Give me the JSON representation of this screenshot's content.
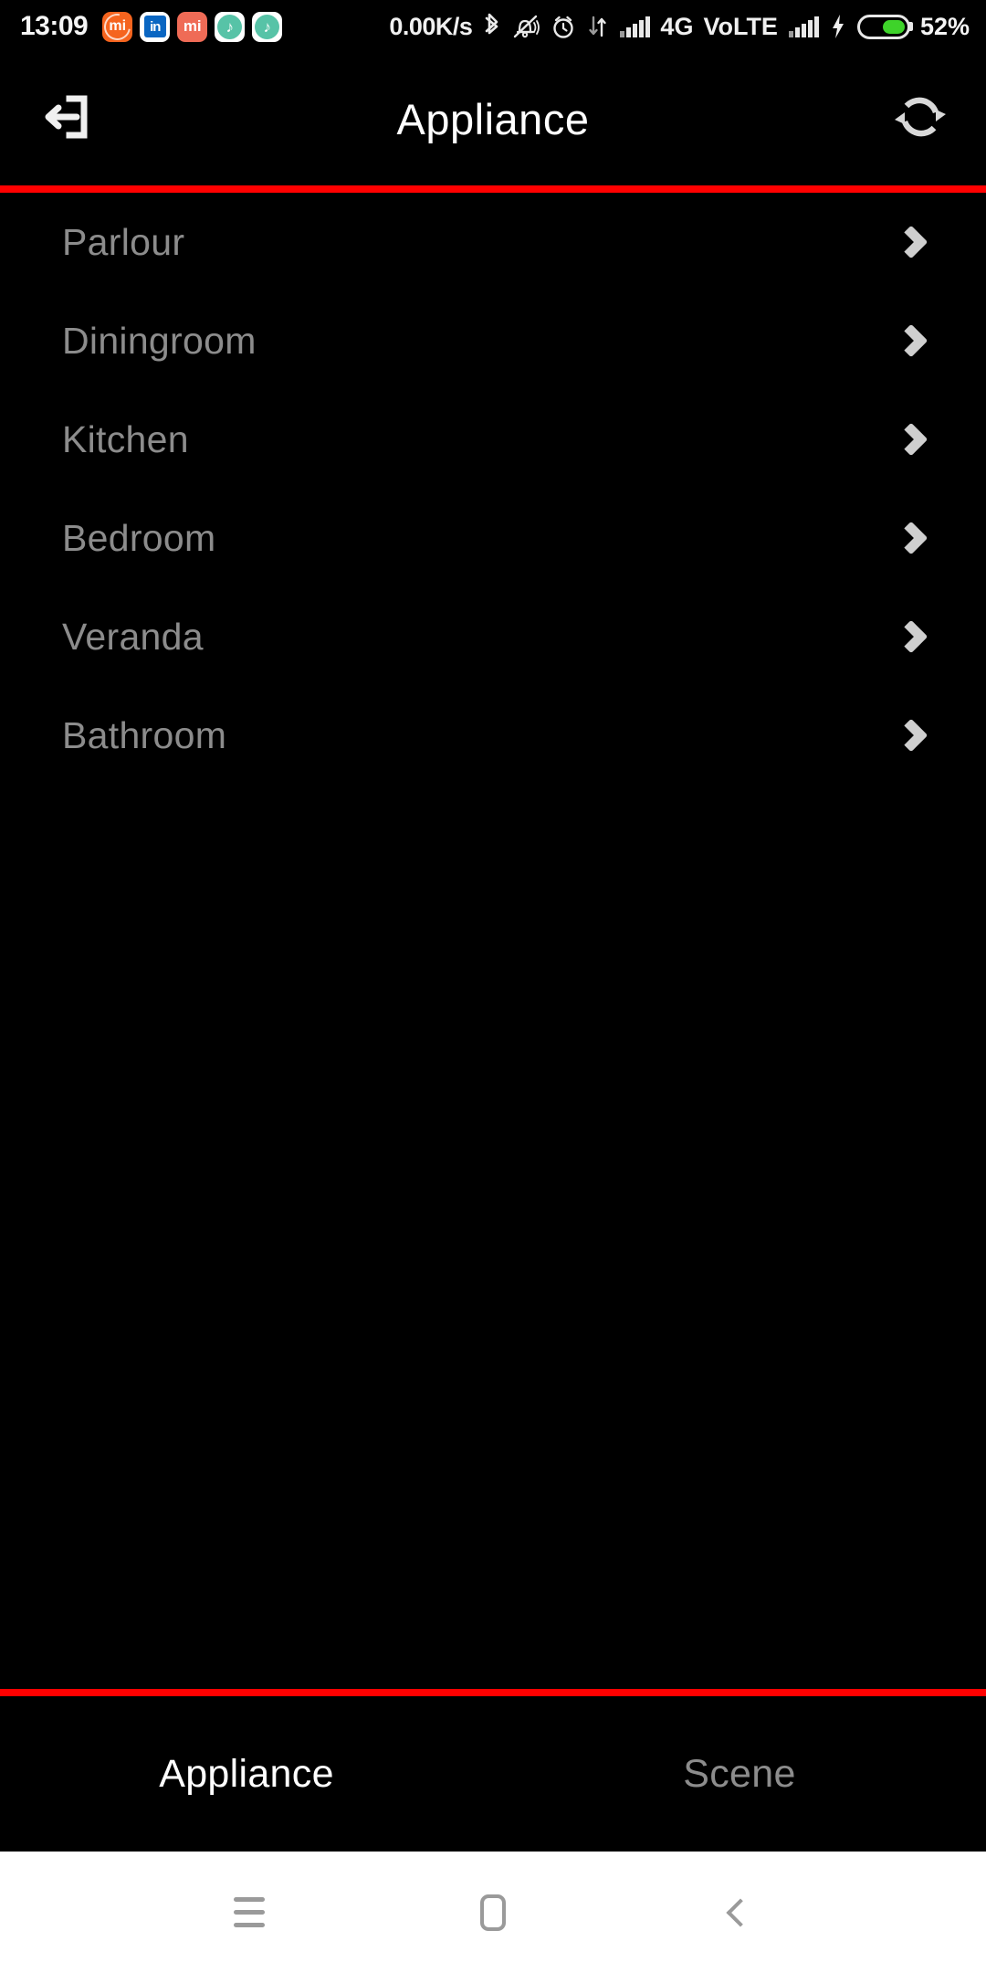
{
  "status_bar": {
    "clock": "13:09",
    "network_speed": "0.00K/s",
    "network_type": "4G",
    "volte_label": "VoLTE",
    "battery_percent": "52%",
    "battery_level": 52,
    "app_icons": [
      {
        "name": "mi-browser-icon",
        "glyph": "mi"
      },
      {
        "name": "linkedin-icon",
        "glyph": "in"
      },
      {
        "name": "mi-video-icon",
        "glyph": "mi"
      },
      {
        "name": "music-icon",
        "glyph": "♪"
      },
      {
        "name": "music-icon-2",
        "glyph": "♪"
      }
    ],
    "system_icons": [
      "bluetooth-icon",
      "mute-bell-icon",
      "alarm-clock-icon",
      "data-transfer-icon",
      "signal-bars-icon",
      "signal-bars-icon-2",
      "charging-bolt-icon"
    ]
  },
  "title_bar": {
    "title": "Appliance",
    "left_icon": "exit-icon",
    "right_icon": "refresh-icon"
  },
  "accent_color": "#ff0000",
  "list": {
    "items": [
      {
        "label": "Parlour",
        "chevron": "chevron-right-icon"
      },
      {
        "label": "Diningroom",
        "chevron": "chevron-right-icon"
      },
      {
        "label": "Kitchen",
        "chevron": "chevron-right-icon"
      },
      {
        "label": "Bedroom",
        "chevron": "chevron-right-icon"
      },
      {
        "label": "Veranda",
        "chevron": "chevron-right-icon"
      },
      {
        "label": "Bathroom",
        "chevron": "chevron-right-icon"
      }
    ]
  },
  "tab_bar": {
    "tabs": [
      {
        "label": "Appliance",
        "active": true
      },
      {
        "label": "Scene",
        "active": false
      }
    ]
  },
  "nav_bar": {
    "buttons": [
      {
        "name": "recents-button",
        "icon": "hamburger-icon"
      },
      {
        "name": "home-button",
        "icon": "home-square-icon"
      },
      {
        "name": "back-button",
        "icon": "chevron-left-icon"
      }
    ]
  }
}
